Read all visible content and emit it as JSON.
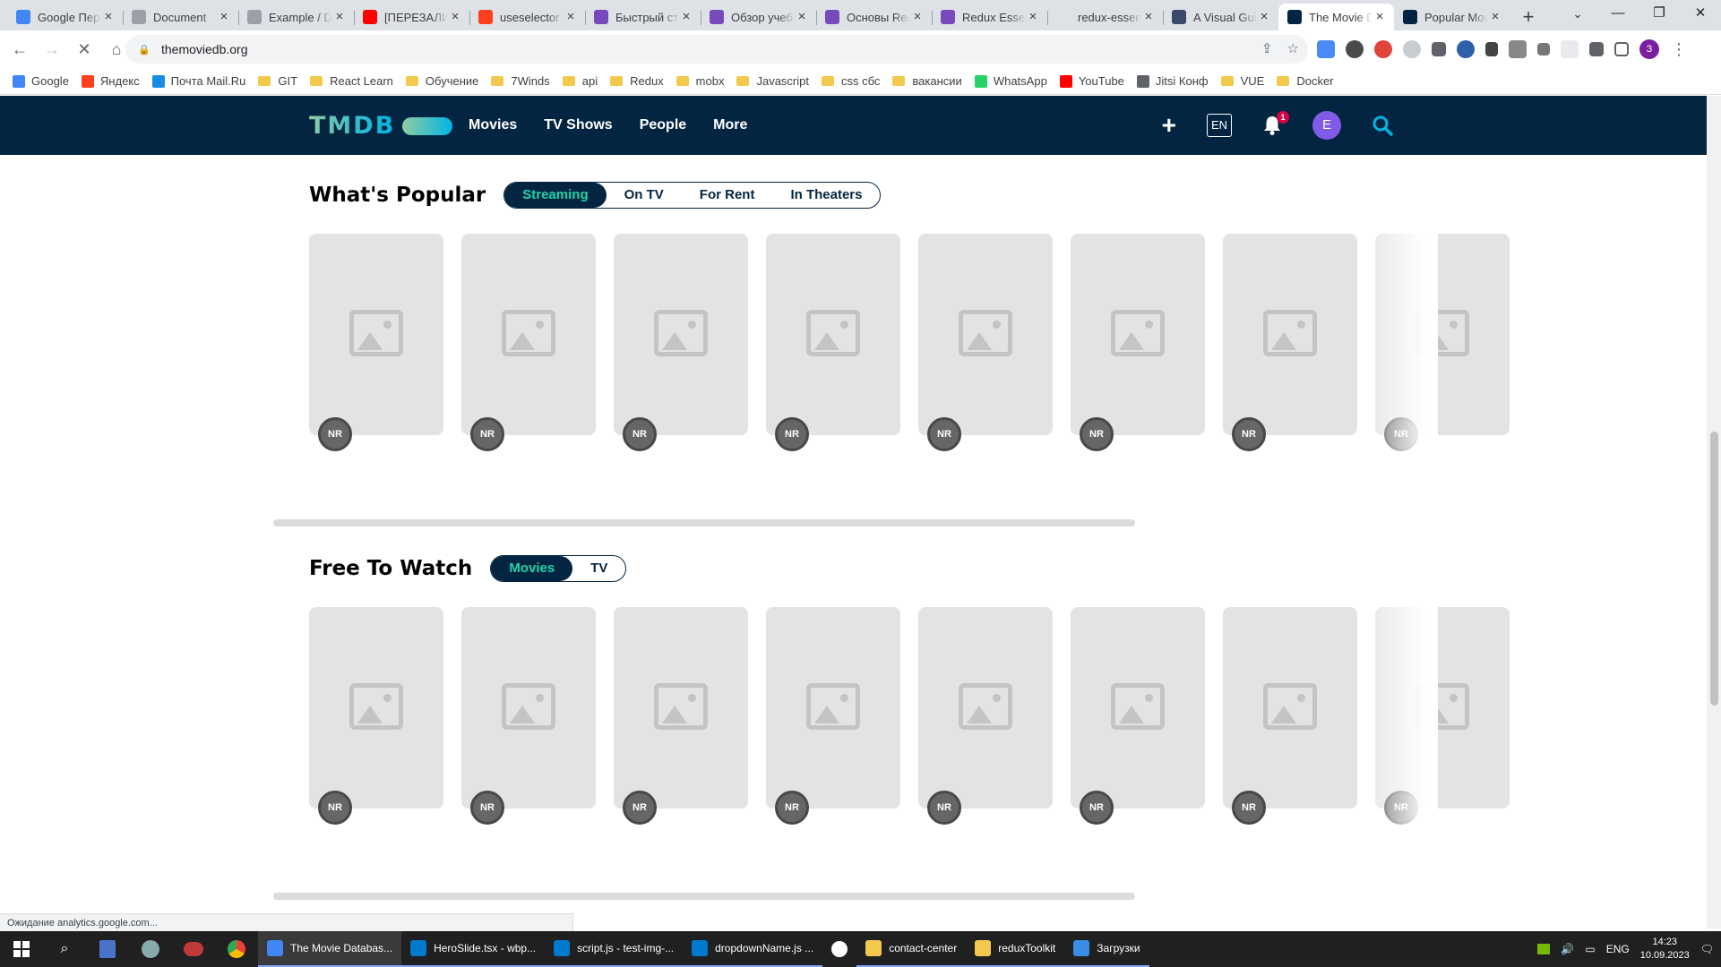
{
  "browser": {
    "tabs": [
      {
        "title": "Google Переводчик",
        "favicon_color": "#4285f4",
        "favicon_icon": "translate-icon"
      },
      {
        "title": "Document",
        "favicon_color": "#9aa0a6",
        "favicon_icon": "globe-icon"
      },
      {
        "title": "Example / Docs",
        "favicon_color": "#9aa0a6",
        "favicon_icon": "globe-icon"
      },
      {
        "title": "[ПЕРЕЗАЛИВ]",
        "favicon_color": "#ff0000",
        "favicon_icon": "youtube-icon"
      },
      {
        "title": "useselector",
        "favicon_color": "#fc3f1d",
        "favicon_icon": "yandex-icon"
      },
      {
        "title": "Быстрый старт",
        "favicon_color": "#764abc",
        "favicon_icon": "redux-icon"
      },
      {
        "title": "Обзор учебника",
        "favicon_color": "#764abc",
        "favicon_icon": "redux-icon"
      },
      {
        "title": "Основы Redux",
        "favicon_color": "#764abc",
        "favicon_icon": "redux-icon"
      },
      {
        "title": "Redux Essentials",
        "favicon_color": "#764abc",
        "favicon_icon": "redux-icon"
      },
      {
        "title": "redux-essentials",
        "favicon_color": "#dee1e6",
        "favicon_icon": "blank-icon"
      },
      {
        "title": "A Visual Guide",
        "favicon_color": "#3b4a6b",
        "favicon_icon": "dev-icon"
      },
      {
        "title": "The Movie Database",
        "favicon_color": "#032541",
        "favicon_icon": "tmdb-icon",
        "active": true
      },
      {
        "title": "Popular Movies",
        "favicon_color": "#032541",
        "favicon_icon": "tmdb-icon"
      }
    ],
    "new_tab_label": "+",
    "url": "themoviedb.org",
    "window_controls": {
      "minimize": "—",
      "maximize": "❐",
      "close": "✕"
    },
    "profile_initial": "З"
  },
  "bookmarks": [
    {
      "label": "Google",
      "type": "site",
      "color": "#4285f4"
    },
    {
      "label": "Яндекс",
      "type": "site",
      "color": "#fc3f1d"
    },
    {
      "label": "Почта Mail.Ru",
      "type": "site",
      "color": "#168de2"
    },
    {
      "label": "GIT",
      "type": "folder"
    },
    {
      "label": "React Learn",
      "type": "folder"
    },
    {
      "label": "Обучение",
      "type": "folder"
    },
    {
      "label": "7Winds",
      "type": "folder"
    },
    {
      "label": "api",
      "type": "folder"
    },
    {
      "label": "Redux",
      "type": "folder"
    },
    {
      "label": "mobx",
      "type": "folder"
    },
    {
      "label": "Javascript",
      "type": "folder"
    },
    {
      "label": "css сбс",
      "type": "folder"
    },
    {
      "label": "вакансии",
      "type": "folder"
    },
    {
      "label": "WhatsApp",
      "type": "site",
      "color": "#25d366"
    },
    {
      "label": "YouTube",
      "type": "site",
      "color": "#ff0000"
    },
    {
      "label": "Jitsi Конф",
      "type": "site",
      "color": "#5f6368"
    },
    {
      "label": "VUE",
      "type": "folder"
    },
    {
      "label": "Docker",
      "type": "folder"
    }
  ],
  "site": {
    "logo": "TMDB",
    "nav": [
      "Movies",
      "TV Shows",
      "People",
      "More"
    ],
    "language": "EN",
    "notification_count": "1",
    "user_initial": "E",
    "colors": {
      "header_bg": "#032541",
      "accent": "#1ed5a9",
      "avatar": "#805be7",
      "badge": "#d40242"
    }
  },
  "sections": [
    {
      "title": "What's Popular",
      "options": [
        "Streaming",
        "On TV",
        "For Rent",
        "In Theaters"
      ],
      "selected": "Streaming",
      "cards": [
        "NR",
        "NR",
        "NR",
        "NR",
        "NR",
        "NR",
        "NR",
        "NR"
      ]
    },
    {
      "title": "Free To Watch",
      "options": [
        "Movies",
        "TV"
      ],
      "selected": "Movies",
      "cards": [
        "NR",
        "NR",
        "NR",
        "NR",
        "NR",
        "NR",
        "NR",
        "NR"
      ]
    }
  ],
  "status_text": "Ожидание analytics.google.com...",
  "taskbar": {
    "apps": [
      {
        "label": "The Movie Databas...",
        "color": "#4285f4",
        "icon": "chrome-icon",
        "active": true
      },
      {
        "label": "HeroSlide.tsx - wbp...",
        "color": "#007acc",
        "icon": "vscode-icon"
      },
      {
        "label": "script.js - test-img-...",
        "color": "#007acc",
        "icon": "vscode-icon"
      },
      {
        "label": "dropdownName.js ...",
        "color": "#007acc",
        "icon": "vscode-icon"
      },
      {
        "label": "",
        "color": "#ffffff",
        "icon": "yandex-browser-icon"
      },
      {
        "label": "contact-center",
        "color": "#f2c94c",
        "icon": "folder-icon"
      },
      {
        "label": "reduxToolkit",
        "color": "#f2c94c",
        "icon": "folder-icon"
      },
      {
        "label": "Загрузки",
        "color": "#3a8ee6",
        "icon": "download-icon"
      }
    ],
    "language": "ENG",
    "time": "14:23",
    "date": "10.09.2023"
  }
}
